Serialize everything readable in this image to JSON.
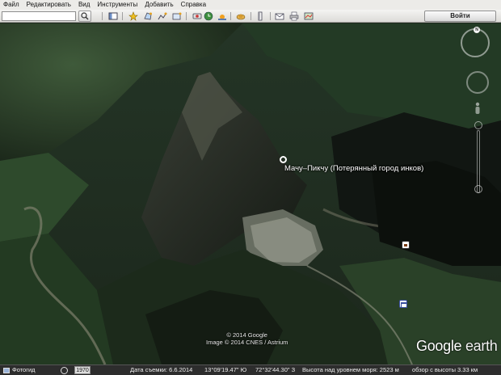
{
  "menu": {
    "items": [
      {
        "label": "Файл"
      },
      {
        "label": "Редактировать"
      },
      {
        "label": "Вид"
      },
      {
        "label": "Инструменты"
      },
      {
        "label": "Добавить"
      },
      {
        "label": "Справка"
      }
    ]
  },
  "toolbar": {
    "search_value": "",
    "search_icon": "search-icon",
    "buttons": [
      {
        "name": "sidebar-toggle",
        "icon": "sidebar-icon"
      },
      {
        "name": "add-placemark",
        "icon": "placemark-icon"
      },
      {
        "name": "add-polygon",
        "icon": "polygon-icon"
      },
      {
        "name": "add-path",
        "icon": "path-icon"
      },
      {
        "name": "add-overlay",
        "icon": "overlay-icon"
      },
      {
        "name": "record-tour",
        "icon": "record-icon"
      },
      {
        "name": "historical-imagery",
        "icon": "clock-icon"
      },
      {
        "name": "sunlight",
        "icon": "sun-icon"
      },
      {
        "name": "switch-planet",
        "icon": "planet-icon"
      },
      {
        "name": "ruler",
        "icon": "ruler-icon"
      },
      {
        "name": "email",
        "icon": "email-icon"
      },
      {
        "name": "print",
        "icon": "print-icon"
      },
      {
        "name": "view-in-maps",
        "icon": "maps-icon"
      }
    ],
    "login_label": "Войти"
  },
  "map": {
    "place_label": "Мачу–Пикчу (Потерянный город инков)",
    "copyright_line1": "© 2014 Google",
    "copyright_line2": "Image © 2014 CNES / Astrium",
    "logo_google": "Google",
    "logo_earth": "earth",
    "compass_north": "N"
  },
  "statusbar": {
    "photos_label": "Фотогид",
    "year": "1970",
    "imagery_date": "Дата съемки: 6.6.2014",
    "latitude": "13°09'19.47\" Ю",
    "longitude": "72°32'44.30\" З",
    "elevation": "Высота над уровнем моря:  2523 м",
    "eye_altitude": "обзор с высоты   3.33 км"
  },
  "colors": {
    "menubar": "#ecebe8",
    "statusbar": "#2d2d2d",
    "label_text": "#ffffff"
  }
}
